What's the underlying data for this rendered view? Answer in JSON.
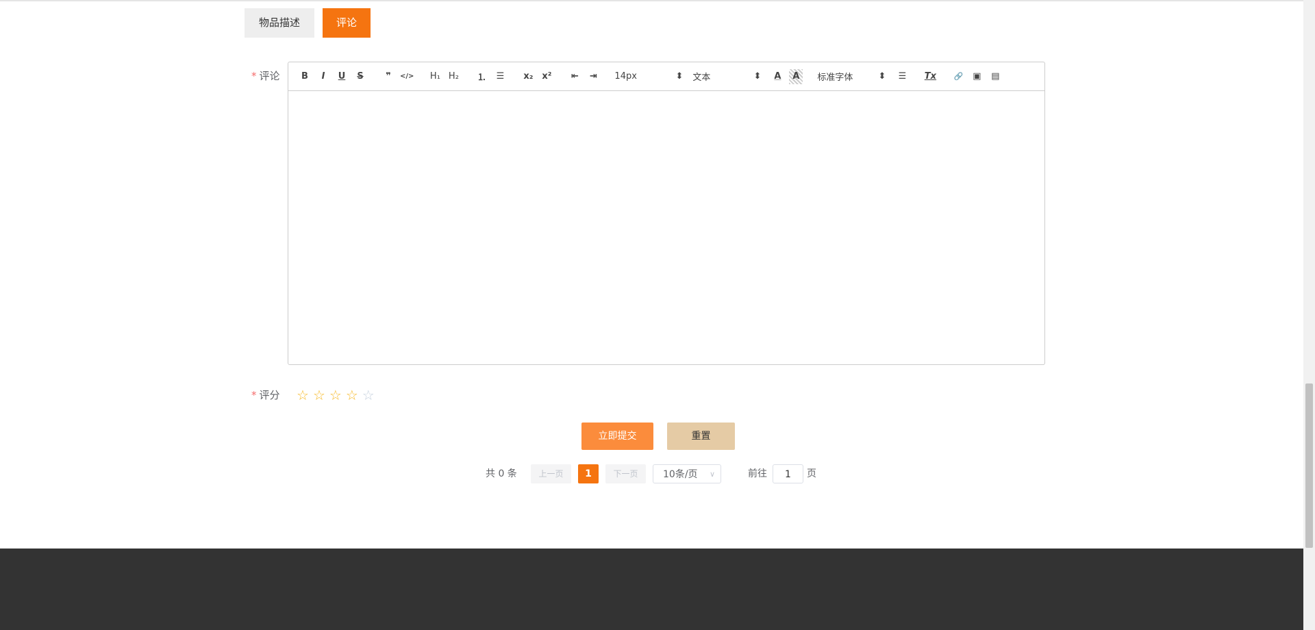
{
  "tabs": [
    {
      "label": "物品描述",
      "active": false
    },
    {
      "label": "评论",
      "active": true
    }
  ],
  "form": {
    "required_mark": "*",
    "comment_label": "评论",
    "rating_label": "评分",
    "rating_value": 4,
    "rating_max": 5,
    "editor": {
      "font_size": "14px",
      "header": "文本",
      "font_family": "标准字体",
      "content": "",
      "tools": {
        "bold": "B",
        "italic": "I",
        "underline": "U",
        "strike": "S",
        "quote": "❞",
        "code": "</>",
        "h1": "H₁",
        "h2": "H₂",
        "ol": "⒈",
        "ul": "☰",
        "sub": "x₂",
        "sup": "x²",
        "outdent": "⇤",
        "indent": "⇥",
        "color": "A",
        "background": "A",
        "align": "☰",
        "clean": "Tx",
        "link": "🔗",
        "image": "▣",
        "video": "▤"
      }
    },
    "submit_label": "立即提交",
    "reset_label": "重置"
  },
  "pagination": {
    "total_text": "共 0 条",
    "prev": "上一页",
    "current": "1",
    "next": "下一页",
    "page_size": "10条/页",
    "goto_label": "前往",
    "goto_value": "1",
    "page_suffix": "页"
  },
  "colors": {
    "accent": "#f57410",
    "submit": "#fb8c3c",
    "reset": "#e5cba5",
    "footer": "#333333",
    "star_on": "#f7ba2a",
    "star_off": "#c6d1de"
  }
}
